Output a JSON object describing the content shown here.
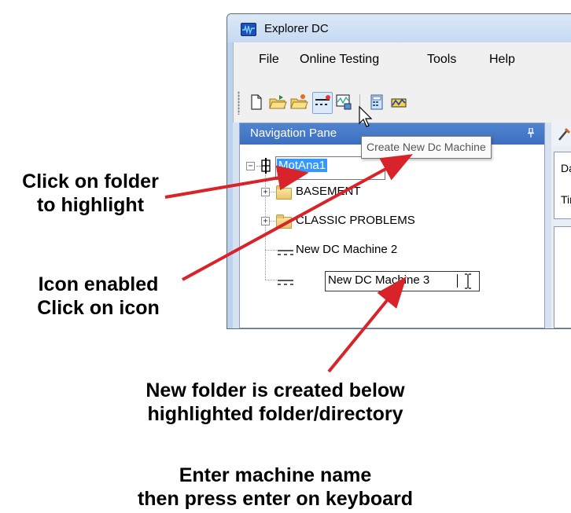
{
  "window": {
    "title": "Explorer DC",
    "menu": [
      "File",
      "Online Testing",
      "Tools",
      "Help"
    ],
    "toolbar_icons": [
      "new-file-icon",
      "open-folder-icon",
      "open-recent-icon",
      "create-dc-machine-icon",
      "scope-icon",
      "calculator-icon",
      "chart-icon"
    ]
  },
  "tooltip": "Create New Dc Machine",
  "nav_pane": {
    "title": "Navigation Pane",
    "pin_glyph": "❡",
    "tree": {
      "root": "MotAna1",
      "children": [
        "BASEMENT",
        "CLASSIC PROBLEMS",
        "New DC Machine 2"
      ],
      "editing_value": "New DC Machine 3"
    }
  },
  "right_pane": {
    "label_1": "Da",
    "label_2": "Tir"
  },
  "annotations": {
    "click_folder": [
      "Click on folder",
      "to highlight"
    ],
    "icon_enabled": [
      "Icon enabled",
      "Click on icon"
    ],
    "new_folder": [
      "New folder is created below",
      "highlighted folder/directory"
    ],
    "enter_name": [
      "Enter machine name",
      "then press enter on keyboard"
    ]
  },
  "colors": {
    "arrow": "#d8232a",
    "selection": "#3399ff",
    "nav_header": "#4a7fcf"
  }
}
